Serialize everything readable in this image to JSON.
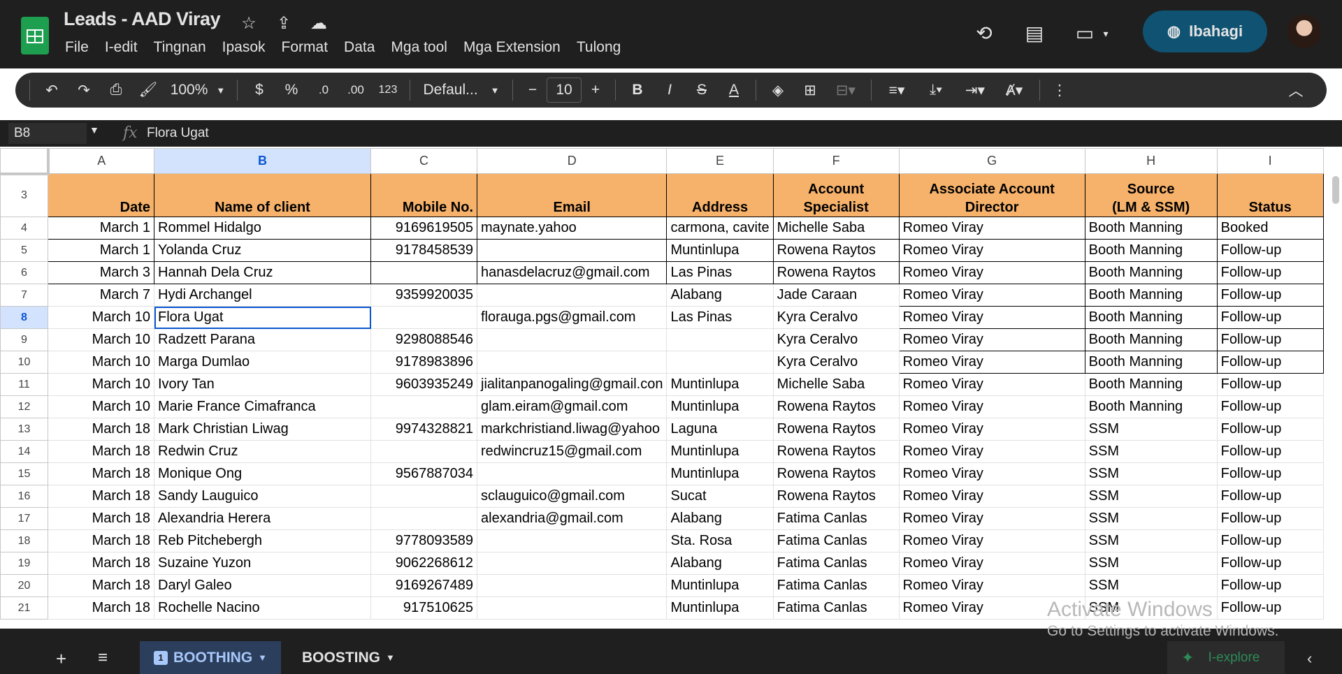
{
  "app": {
    "title": "Leads - AAD Viray",
    "menu": [
      "File",
      "I-edit",
      "Tingnan",
      "Ipasok",
      "Format",
      "Data",
      "Mga tool",
      "Mga Extension",
      "Tulong"
    ],
    "share_label": "Ibahagi"
  },
  "toolbar": {
    "zoom": "100%",
    "currency": "$",
    "percent": "%",
    "dec_less": ".0",
    "dec_more": ".00",
    "more_formats": "123",
    "font": "Defaul...",
    "font_size": "10",
    "bold": "B",
    "italic": "I",
    "text_color": "A"
  },
  "formula_bar": {
    "name_box": "B8",
    "fx": "fx",
    "value": "Flora Ugat"
  },
  "columns": [
    "A",
    "B",
    "C",
    "D",
    "E",
    "F",
    "G",
    "H",
    "I"
  ],
  "header_row": {
    "row_num": "3",
    "cells": [
      "Date",
      "Name of client",
      "Mobile No.",
      "Email",
      "Address",
      "Account Specialist",
      "Associate Account Director",
      "Source\n(LM & SSM)",
      "Status"
    ]
  },
  "rows": [
    {
      "n": "4",
      "c": [
        "March 1",
        "Rommel Hidalgo",
        "9169619505",
        "maynate.yahoo",
        "carmona, cavite",
        "Michelle Saba",
        "Romeo Viray",
        "Booth Manning",
        "Booked"
      ]
    },
    {
      "n": "5",
      "c": [
        "March 1",
        "Yolanda Cruz",
        "9178458539",
        "",
        "Muntinlupa",
        "Rowena Raytos",
        "Romeo Viray",
        "Booth Manning",
        " Follow-up"
      ]
    },
    {
      "n": "6",
      "c": [
        "March 3",
        "Hannah Dela Cruz",
        "",
        "hanasdelacruz@gmail.com",
        "Las Pinas",
        "Rowena Raytos",
        "Romeo Viray",
        "Booth Manning",
        "Follow-up"
      ]
    },
    {
      "n": "7",
      "c": [
        "March 7",
        "Hydi Archangel",
        "9359920035",
        "",
        "Alabang",
        "Jade Caraan",
        "Romeo Viray",
        "Booth Manning",
        "Follow-up"
      ]
    },
    {
      "n": "8",
      "c": [
        "March 10",
        "Flora Ugat",
        "",
        "florauga.pgs@gmail.com",
        "Las Pinas",
        "Kyra Ceralvo",
        "Romeo Viray",
        "Booth Manning",
        "Follow-up"
      ]
    },
    {
      "n": "9",
      "c": [
        "March 10",
        "Radzett Parana",
        "9298088546",
        "",
        "",
        "Kyra Ceralvo",
        "Romeo Viray",
        "Booth Manning",
        "Follow-up"
      ]
    },
    {
      "n": "10",
      "c": [
        "March 10",
        "Marga Dumlao",
        "9178983896",
        "",
        "",
        "Kyra Ceralvo",
        "Romeo Viray",
        "Booth Manning",
        "Follow-up"
      ]
    },
    {
      "n": "11",
      "c": [
        "March 10",
        "Ivory Tan",
        "9603935249",
        "jialitanpanogaling@gmail.con",
        "Muntinlupa",
        "Michelle Saba",
        "Romeo Viray",
        "Booth Manning",
        "Follow-up"
      ]
    },
    {
      "n": "12",
      "c": [
        "March 10",
        "Marie France Cimafranca",
        "",
        "glam.eiram@gmail.com",
        "Muntinlupa",
        "Rowena Raytos",
        "Romeo Viray",
        "Booth Manning",
        "Follow-up"
      ]
    },
    {
      "n": "13",
      "c": [
        "March 18",
        "Mark Christian Liwag",
        "9974328821",
        "markchristiand.liwag@yahoo",
        "Laguna",
        "Rowena Raytos",
        "Romeo Viray",
        "SSM",
        "Follow-up"
      ]
    },
    {
      "n": "14",
      "c": [
        "March 18",
        "Redwin Cruz",
        "",
        "redwincruz15@gmail.com",
        "Muntinlupa",
        "Rowena Raytos",
        "Romeo Viray",
        "SSM",
        "Follow-up"
      ]
    },
    {
      "n": "15",
      "c": [
        "March 18",
        "Monique Ong",
        "9567887034",
        "",
        "Muntinlupa",
        "Rowena Raytos",
        "Romeo Viray",
        "SSM",
        "Follow-up"
      ]
    },
    {
      "n": "16",
      "c": [
        "March 18",
        "Sandy Lauguico",
        "",
        "sclauguico@gmail.com",
        "Sucat",
        "Rowena Raytos",
        "Romeo Viray",
        "SSM",
        "Follow-up"
      ]
    },
    {
      "n": "17",
      "c": [
        "March 18",
        "Alexandria Herera",
        "",
        "alexandria@gmail.com",
        "Alabang",
        "Fatima Canlas",
        "Romeo Viray",
        "SSM",
        "Follow-up"
      ]
    },
    {
      "n": "18",
      "c": [
        "March 18",
        "Reb Pitchebergh",
        "9778093589",
        "",
        "Sta. Rosa",
        "Fatima Canlas",
        "Romeo Viray",
        "SSM",
        "Follow-up"
      ]
    },
    {
      "n": "19",
      "c": [
        "March 18",
        "Suzaine Yuzon",
        "9062268612",
        "",
        "Alabang",
        "Fatima Canlas",
        "Romeo Viray",
        "SSM",
        "Follow-up"
      ]
    },
    {
      "n": "20",
      "c": [
        "March 18",
        "Daryl Galeo",
        "9169267489",
        "",
        "Muntinlupa",
        "Fatima Canlas",
        "Romeo Viray",
        "SSM",
        "Follow-up"
      ]
    },
    {
      "n": "21",
      "c": [
        "March 18",
        "Rochelle Nacino",
        "917510625",
        "",
        "Muntinlupa",
        "Fatima Canlas",
        "Romeo Viray",
        "SSM",
        "Follow-up"
      ]
    }
  ],
  "sheets": {
    "active_num": "1",
    "tabs": [
      "BOOTHING",
      "BOOSTING"
    ],
    "explore": "I-explore"
  },
  "watermark": {
    "line1": "Activate Windows",
    "line2": "Go to Settings to activate Windows."
  },
  "colors": {
    "header_fill": "#f6b26b",
    "selection": "#0b57d0"
  }
}
